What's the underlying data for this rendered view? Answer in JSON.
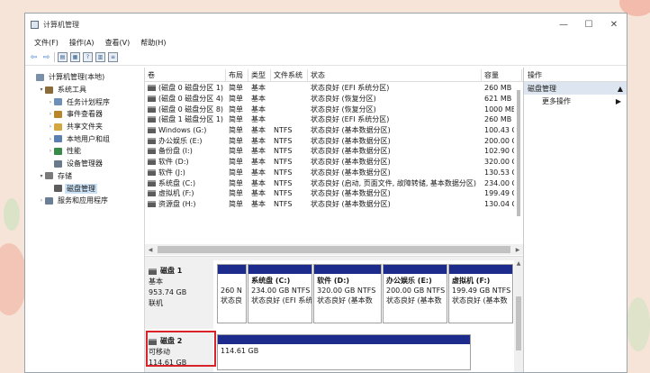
{
  "window": {
    "title": "计算机管理",
    "minimize": "—",
    "maximize": "☐",
    "close": "✕"
  },
  "menu": [
    "文件(F)",
    "操作(A)",
    "查看(V)",
    "帮助(H)"
  ],
  "toolbar_icons": [
    "back-icon",
    "forward-icon",
    "folder-icon",
    "properties-icon",
    "help-icon",
    "show-pane-icon",
    "list-icon"
  ],
  "tree": [
    {
      "label": "计算机管理(本地)",
      "level": 0,
      "exp": "",
      "icon": "#7a8fa8"
    },
    {
      "label": "系统工具",
      "level": 1,
      "exp": "▾",
      "icon": "#8a6b3a"
    },
    {
      "label": "任务计划程序",
      "level": 2,
      "exp": "›",
      "icon": "#6d8fb8"
    },
    {
      "label": "事件查看器",
      "level": 2,
      "exp": "›",
      "icon": "#b8862a"
    },
    {
      "label": "共享文件夹",
      "level": 2,
      "exp": "›",
      "icon": "#d4a640"
    },
    {
      "label": "本地用户和组",
      "level": 2,
      "exp": "›",
      "icon": "#5a7fb0"
    },
    {
      "label": "性能",
      "level": 2,
      "exp": "›",
      "icon": "#3a8a4a"
    },
    {
      "label": "设备管理器",
      "level": 2,
      "exp": "",
      "icon": "#6a7a8a"
    },
    {
      "label": "存储",
      "level": 1,
      "exp": "▾",
      "icon": "#7a7a7a"
    },
    {
      "label": "磁盘管理",
      "level": 2,
      "exp": "",
      "icon": "#5c5c5c",
      "selected": true
    },
    {
      "label": "服务和应用程序",
      "level": 1,
      "exp": "›",
      "icon": "#6a7f95"
    }
  ],
  "columns": [
    "卷",
    "布局",
    "类型",
    "文件系统",
    "状态",
    "容量"
  ],
  "volumes": [
    [
      "(磁盘 0 磁盘分区 1)",
      "简单",
      "基本",
      "",
      "状态良好 (EFI 系统分区)",
      "260 MB"
    ],
    [
      "(磁盘 0 磁盘分区 4)",
      "简单",
      "基本",
      "",
      "状态良好 (恢复分区)",
      "621 MB"
    ],
    [
      "(磁盘 0 磁盘分区 8)",
      "简单",
      "基本",
      "",
      "状态良好 (恢复分区)",
      "1000 MB"
    ],
    [
      "(磁盘 1 磁盘分区 1)",
      "简单",
      "基本",
      "",
      "状态良好 (EFI 系统分区)",
      "260 MB"
    ],
    [
      "Windows (G:)",
      "简单",
      "基本",
      "NTFS",
      "状态良好 (基本数据分区)",
      "100.43 GB"
    ],
    [
      "办公娱乐 (E:)",
      "简单",
      "基本",
      "NTFS",
      "状态良好 (基本数据分区)",
      "200.00 GB"
    ],
    [
      "备份盘 (I:)",
      "简单",
      "基本",
      "NTFS",
      "状态良好 (基本数据分区)",
      "102.90 GB"
    ],
    [
      "软件 (D:)",
      "简单",
      "基本",
      "NTFS",
      "状态良好 (基本数据分区)",
      "320.00 GB"
    ],
    [
      "软件 (J:)",
      "简单",
      "基本",
      "NTFS",
      "状态良好 (基本数据分区)",
      "130.53 GB"
    ],
    [
      "系统盘 (C:)",
      "简单",
      "基本",
      "NTFS",
      "状态良好 (启动, 页面文件, 故障转储, 基本数据分区)",
      "234.00 GB"
    ],
    [
      "虚拟机 (F:)",
      "简单",
      "基本",
      "NTFS",
      "状态良好 (基本数据分区)",
      "199.49 GB"
    ],
    [
      "资源盘 (H:)",
      "简单",
      "基本",
      "NTFS",
      "状态良好 (基本数据分区)",
      "130.04 GB"
    ]
  ],
  "disk1": {
    "name": "磁盘 1",
    "type": "基本",
    "size": "953.74 GB",
    "status": "联机",
    "parts": [
      {
        "name": "",
        "size": "260 N",
        "status": "状态良"
      },
      {
        "name": "系统盘 (C:)",
        "size": "234.00 GB NTFS",
        "status": "状态良好 (EFI 系统分区)"
      },
      {
        "name": "软件 (D:)",
        "size": "320.00 GB NTFS",
        "status": "状态良好 (基本数"
      },
      {
        "name": "办公娱乐 (E:)",
        "size": "200.00 GB NTFS",
        "status": "状态良好 (基本数"
      },
      {
        "name": "虚拟机 (F:)",
        "size": "199.49 GB NTFS",
        "status": "状态良好 (基本数"
      }
    ]
  },
  "disk2": {
    "name": "磁盘 2",
    "type": "可移动",
    "size": "114.61 GB",
    "part_size": "114.61 GB"
  },
  "actions": {
    "header": "操作",
    "section": "磁盘管理",
    "more": "更多操作"
  },
  "colors": {
    "partition_bar": "#1c2b8c",
    "selection": "#cde3f7",
    "highlight_box": "#d8232a"
  }
}
